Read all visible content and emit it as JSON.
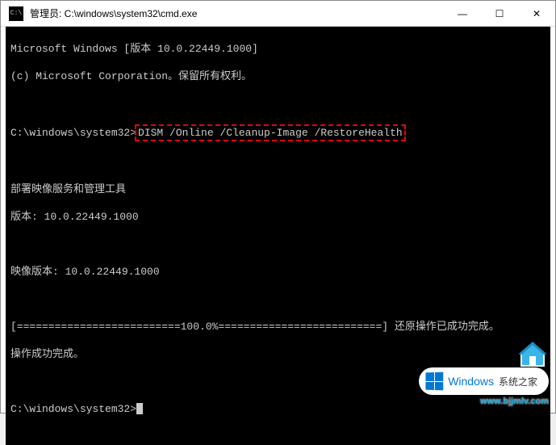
{
  "titlebar": {
    "title": "管理员: C:\\windows\\system32\\cmd.exe",
    "icon_label": "C:\\"
  },
  "controls": {
    "minimize": "—",
    "maximize": "☐",
    "close": "✕"
  },
  "terminal": {
    "line1": "Microsoft Windows [版本 10.0.22449.1000]",
    "line2": "(c) Microsoft Corporation。保留所有权利。",
    "prompt1_prefix": "C:\\windows\\system32>",
    "command1": "DISM /Online /Cleanup-Image /RestoreHealth",
    "line5": "部署映像服务和管理工具",
    "line6": "版本: 10.0.22449.1000",
    "line8": "映像版本: 10.0.22449.1000",
    "progress_line": "[==========================100.0%==========================] 还原操作已成功完成。",
    "line11": "操作成功完成。",
    "prompt2_prefix": "C:\\windows\\system32>"
  },
  "watermark": {
    "brand": "Windows",
    "sub": "系统之家",
    "url": "www.bjjmlv.com"
  }
}
